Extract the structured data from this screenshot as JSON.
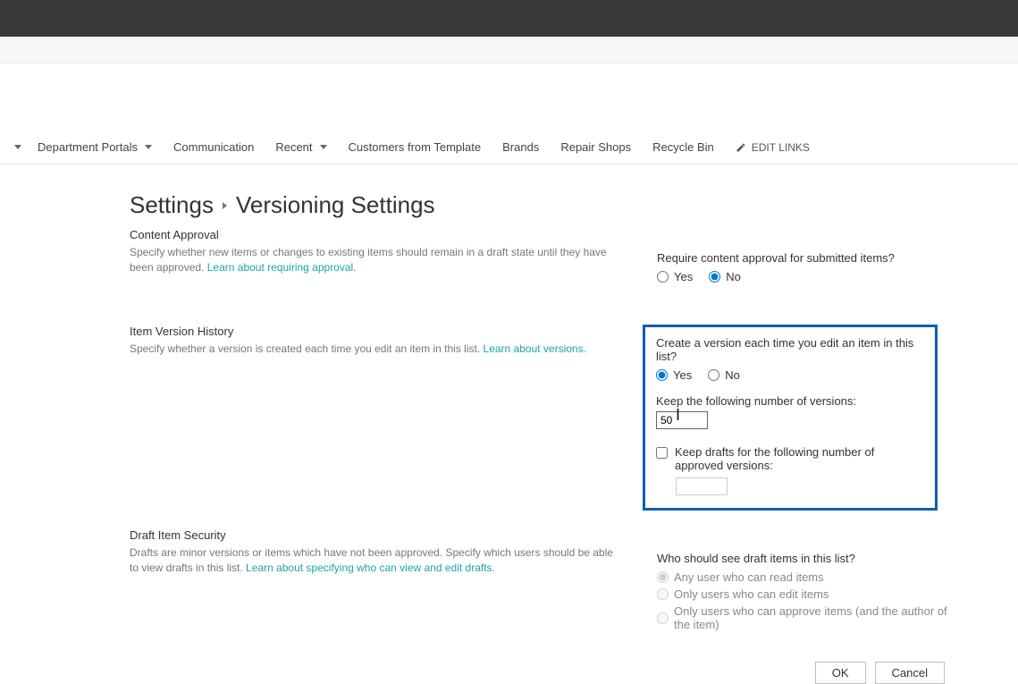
{
  "nav": {
    "items": [
      {
        "label": ""
      },
      {
        "label": "Department Portals"
      },
      {
        "label": "Communication"
      },
      {
        "label": "Recent"
      },
      {
        "label": "Customers from Template"
      },
      {
        "label": "Brands"
      },
      {
        "label": "Repair Shops"
      },
      {
        "label": "Recycle Bin"
      }
    ],
    "edit_links_label": "EDIT LINKS"
  },
  "breadcrumb": {
    "settings": "Settings",
    "current": "Versioning Settings"
  },
  "approval": {
    "title": "Content Approval",
    "desc": "Specify whether new items or changes to existing items should remain in a draft state until they have been approved.  ",
    "learn_link": "Learn about requiring approval.",
    "question": "Require content approval for submitted items?",
    "yes": "Yes",
    "no": "No"
  },
  "versioning": {
    "title": "Item Version History",
    "desc": "Specify whether a version is created each time you edit an item in this list.  ",
    "learn_link": "Learn about versions.",
    "question": "Create a version each time you edit an item in this list?",
    "yes": "Yes",
    "no": "No",
    "keep_versions_label": "Keep the following number of versions:",
    "keep_versions_value": "50",
    "keep_drafts_label": "Keep drafts for the following number of approved versions:",
    "keep_drafts_value": ""
  },
  "drafts": {
    "title": "Draft Item Security",
    "desc": "Drafts are minor versions or items which have not been approved. Specify which users should be able to view drafts in this list.  ",
    "learn_link": "Learn about specifying who can view and edit drafts.",
    "question": "Who should see draft items in this list?",
    "opt_any": "Any user who can read items",
    "opt_edit": "Only users who can edit items",
    "opt_approve": "Only users who can approve items (and the author of the item)"
  },
  "buttons": {
    "ok": "OK",
    "cancel": "Cancel"
  }
}
